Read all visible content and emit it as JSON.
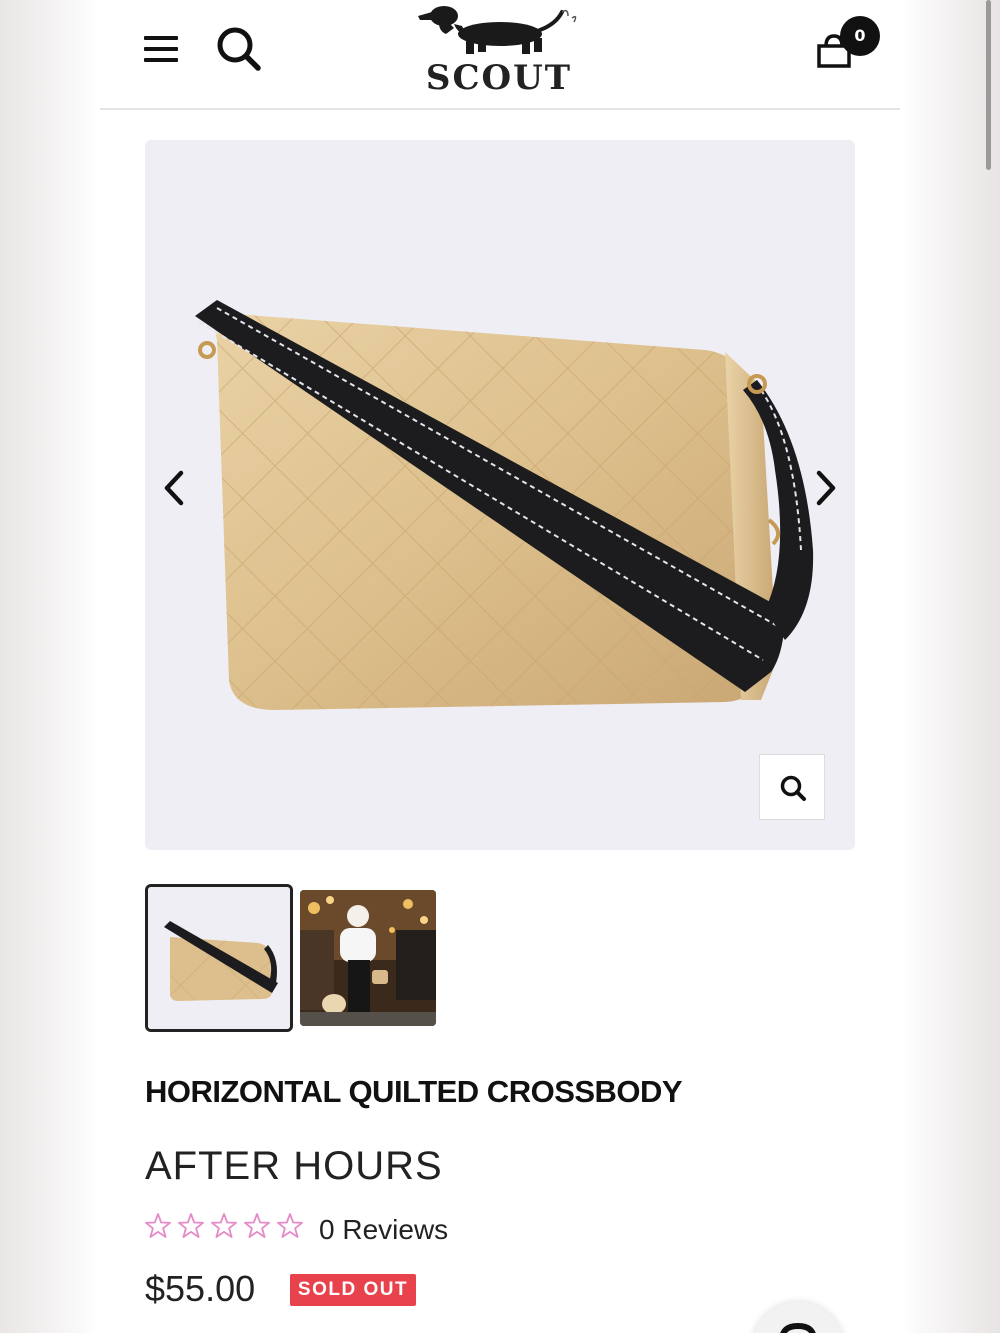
{
  "header": {
    "logo_text": "SCOUT",
    "cart_count": "0"
  },
  "gallery": {
    "prev_icon": "chevron-left-icon",
    "next_icon": "chevron-right-icon",
    "zoom_icon": "search-icon",
    "thumbnail_count": 2,
    "selected_thumbnail": 1
  },
  "product": {
    "title": "HORIZONTAL QUILTED CROSSBODY",
    "variant": "AFTER HOURS",
    "rating_stars": 0,
    "max_stars": 5,
    "reviews_label": "0 Reviews",
    "price": "$55.00",
    "badge": "SOLD OUT"
  },
  "colors": {
    "star_outline": "#e58bc8",
    "badge_bg": "#e8424d",
    "text": "#111111"
  }
}
